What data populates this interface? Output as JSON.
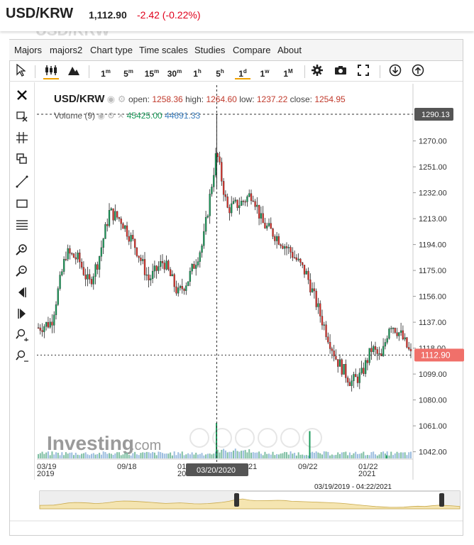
{
  "header": {
    "symbol": "USD/KRW",
    "price": "1,112.90",
    "change": "-2.42 (-0.22%)"
  },
  "ghost_title": "USD/KRW",
  "menu": [
    "Majors",
    "majors2",
    "Chart type",
    "Time scales",
    "Studies",
    "Compare",
    "About"
  ],
  "toolbar": {
    "timescales": [
      "1m",
      "5m",
      "15m",
      "30m",
      "1h",
      "5h",
      "1d",
      "1w",
      "1M"
    ],
    "selected": "1d"
  },
  "legend": {
    "name": "USD/KRW",
    "open_label": "open:",
    "open": "1258.36",
    "high_label": "high:",
    "high": "1264.60",
    "low_label": "low:",
    "low": "1237.22",
    "close_label": "close:",
    "close": "1254.95",
    "volume_label": "Volume (9)",
    "volume_1": "45425.00",
    "volume_2": "44691.33"
  },
  "crosshair": {
    "price_label": "1290.13",
    "date_label": "03/20/2020"
  },
  "last_price_label": "1112.90",
  "watermark": {
    "brand": "Investing",
    "suffix": ".com"
  },
  "navigator": {
    "range_label": "03/19/2019 - 04:22/2021"
  },
  "colors": {
    "up": "#1a9a5a",
    "down": "#d9322b",
    "accent": "#f0a000",
    "nav_fill": "#f4e2a8"
  },
  "chart_data": {
    "type": "candlestick",
    "title": "USD/KRW",
    "y_ticks": [
      1042.0,
      1061.0,
      1080.0,
      1099.0,
      1118.0,
      1137.0,
      1156.0,
      1175.0,
      1194.0,
      1213.0,
      1232.0,
      1251.0,
      1270.0
    ],
    "ylim": [
      1031,
      1310
    ],
    "x_ticks": [
      {
        "top": "03/19",
        "bottom": "2019"
      },
      {
        "top": "09/18",
        "bottom": ""
      },
      {
        "top": "01",
        "bottom": "20"
      },
      {
        "top": "21",
        "bottom": ""
      },
      {
        "top": "09/22",
        "bottom": ""
      },
      {
        "top": "01/22",
        "bottom": "2021"
      }
    ],
    "x_start": "2019-03-19",
    "x_end": "2021-04-22",
    "series": [
      {
        "date": "2019-03-19",
        "close": 1133
      },
      {
        "date": "2019-04-15",
        "close": 1137
      },
      {
        "date": "2019-05-15",
        "close": 1188
      },
      {
        "date": "2019-06-10",
        "close": 1183
      },
      {
        "date": "2019-07-01",
        "close": 1165
      },
      {
        "date": "2019-07-20",
        "close": 1182
      },
      {
        "date": "2019-08-12",
        "close": 1218
      },
      {
        "date": "2019-09-05",
        "close": 1212
      },
      {
        "date": "2019-10-05",
        "close": 1192
      },
      {
        "date": "2019-11-01",
        "close": 1168
      },
      {
        "date": "2019-12-01",
        "close": 1182
      },
      {
        "date": "2019-12-31",
        "close": 1158
      },
      {
        "date": "2020-01-20",
        "close": 1168
      },
      {
        "date": "2020-02-20",
        "close": 1195
      },
      {
        "date": "2020-03-19",
        "close": 1262
      },
      {
        "date": "2020-04-10",
        "close": 1220
      },
      {
        "date": "2020-05-10",
        "close": 1225
      },
      {
        "date": "2020-06-01",
        "close": 1232
      },
      {
        "date": "2020-06-20",
        "close": 1210
      },
      {
        "date": "2020-07-20",
        "close": 1200
      },
      {
        "date": "2020-08-20",
        "close": 1188
      },
      {
        "date": "2020-09-20",
        "close": 1172
      },
      {
        "date": "2020-10-20",
        "close": 1140
      },
      {
        "date": "2020-11-20",
        "close": 1110
      },
      {
        "date": "2020-12-20",
        "close": 1093
      },
      {
        "date": "2021-01-10",
        "close": 1098
      },
      {
        "date": "2021-02-01",
        "close": 1118
      },
      {
        "date": "2021-02-20",
        "close": 1110
      },
      {
        "date": "2021-03-10",
        "close": 1137
      },
      {
        "date": "2021-04-01",
        "close": 1128
      },
      {
        "date": "2021-04-22",
        "close": 1113
      }
    ],
    "volume_spikes": [
      {
        "date": "2020-03-19",
        "value": 45425
      },
      {
        "date": "2020-09-25",
        "value": 35000
      },
      {
        "date": "2021-03-01",
        "value": 4000
      }
    ]
  }
}
